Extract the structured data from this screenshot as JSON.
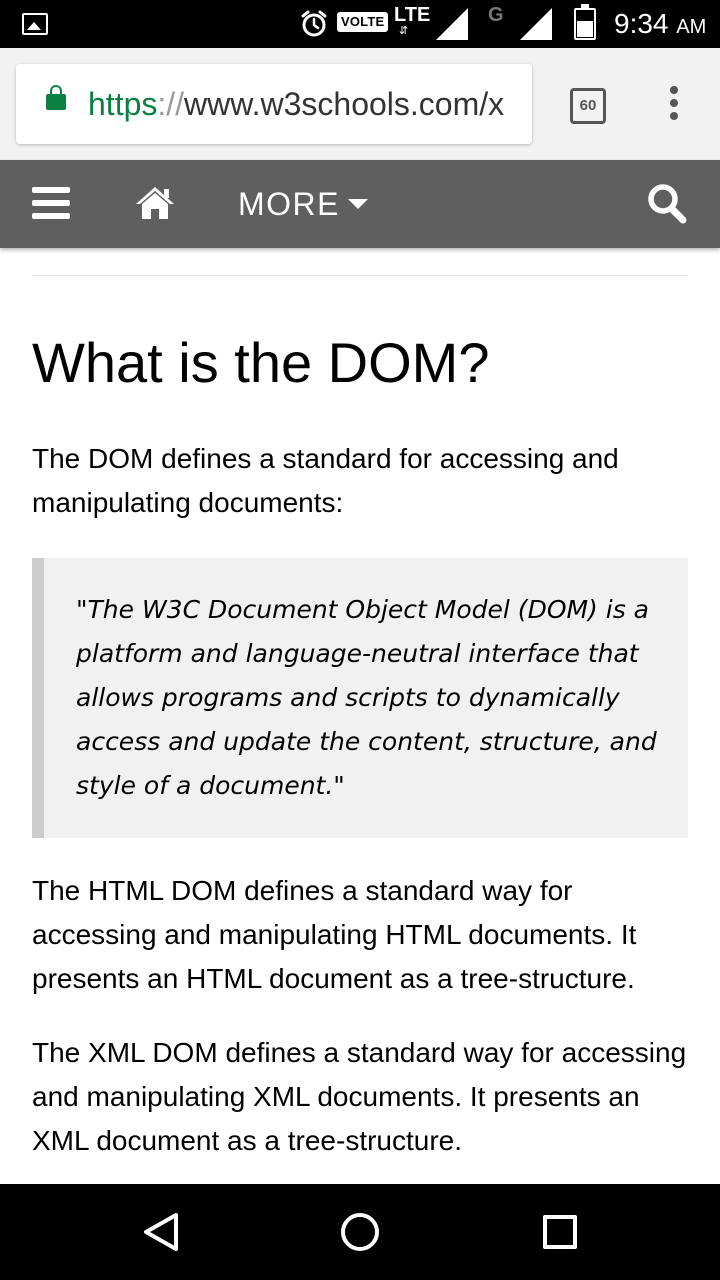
{
  "status_bar": {
    "network_badge": "VOLTE",
    "network_type": "LTE",
    "network_arrows": "⇵",
    "secondary_network": "G",
    "time": "9:34",
    "ampm": "AM"
  },
  "browser": {
    "url_scheme": "https",
    "url_separator": "://",
    "url_rest": "www.w3schools.com/x",
    "tab_count": "60"
  },
  "site_nav": {
    "more_label": "MORE"
  },
  "article": {
    "title": "What is the DOM?",
    "intro": "The DOM defines a standard for accessing and manipulating documents:",
    "quote": "\"The W3C Document Object Model (DOM) is a platform and language-neutral interface that allows programs and scripts to dynamically access and update the content, structure, and style of a document.\"",
    "html_dom": "The HTML DOM defines a standard way for accessing and manipulating HTML documents. It presents an HTML document as a tree-structure.",
    "xml_dom": "The XML DOM defines a standard way for accessing and manipulating XML documents. It presents an XML document as a tree-structure."
  },
  "colors": {
    "nav_bg": "#5f5f5f",
    "url_secure": "#0b8043",
    "quote_bg": "#f1f1f1",
    "quote_border": "#cccccc"
  },
  "icons": {
    "status": [
      "gallery-icon",
      "alarm-icon",
      "signal-icon",
      "battery-icon"
    ],
    "browser": [
      "lock-icon",
      "tab-switcher-icon",
      "overflow-menu-icon"
    ],
    "site": [
      "hamburger-icon",
      "home-icon",
      "caret-down-icon",
      "search-icon"
    ],
    "system": [
      "back-icon",
      "home-circle-icon",
      "recents-icon"
    ]
  }
}
